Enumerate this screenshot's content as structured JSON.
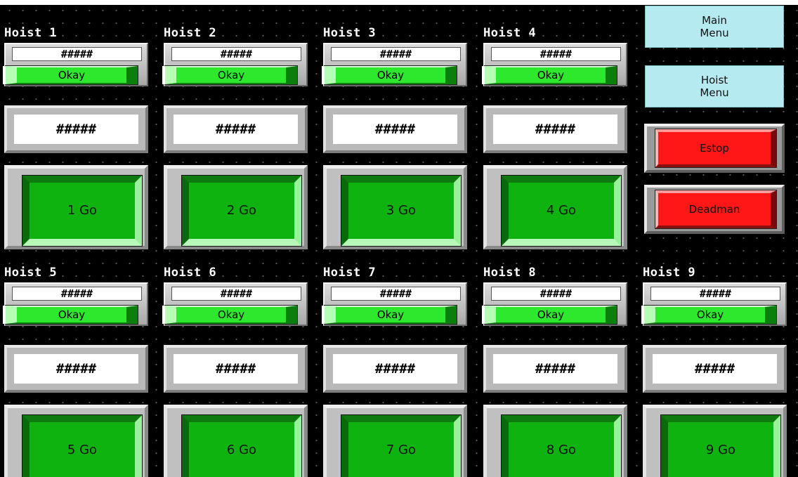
{
  "hoists": [
    {
      "title": "Hoist 1",
      "readout": "#####",
      "status": "Okay",
      "value": "#####",
      "go_label": "1 Go"
    },
    {
      "title": "Hoist 2",
      "readout": "#####",
      "status": "Okay",
      "value": "#####",
      "go_label": "2 Go"
    },
    {
      "title": "Hoist 3",
      "readout": "#####",
      "status": "Okay",
      "value": "#####",
      "go_label": "3 Go"
    },
    {
      "title": "Hoist 4",
      "readout": "#####",
      "status": "Okay",
      "value": "#####",
      "go_label": "4 Go"
    },
    {
      "title": "Hoist 5",
      "readout": "#####",
      "status": "Okay",
      "value": "#####",
      "go_label": "5 Go"
    },
    {
      "title": "Hoist 6",
      "readout": "#####",
      "status": "Okay",
      "value": "#####",
      "go_label": "6 Go"
    },
    {
      "title": "Hoist 7",
      "readout": "#####",
      "status": "Okay",
      "value": "#####",
      "go_label": "7 Go"
    },
    {
      "title": "Hoist 8",
      "readout": "#####",
      "status": "Okay",
      "value": "#####",
      "go_label": "8 Go"
    },
    {
      "title": "Hoist 9",
      "readout": "#####",
      "status": "Okay",
      "value": "#####",
      "go_label": "9 Go"
    }
  ],
  "menu": {
    "main_menu_label": "Main\nMenu",
    "hoist_menu_label": "Hoist\nMenu"
  },
  "controls": {
    "estop_label": "Estop",
    "deadman_label": "Deadman"
  },
  "colors": {
    "background": "#000000",
    "status_okay": "#2ee82e",
    "go_button": "#0fb30f",
    "menu_button": "#b4eaf0",
    "alarm_button": "#ff1616"
  }
}
